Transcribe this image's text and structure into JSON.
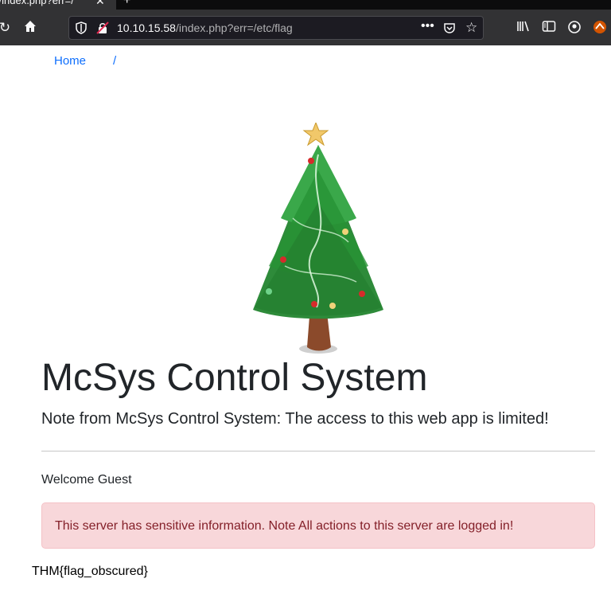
{
  "browser": {
    "tab_title": "s/index.php?err=/",
    "tab_close": "✕",
    "new_tab": "+",
    "url_host": "10.10.15.58",
    "url_path": "/index.php?err=/etc/flag",
    "icons": [
      "reload-icon",
      "home-icon",
      "shield-icon",
      "insecure-lock-icon",
      "more-icon",
      "pocket-icon",
      "bookmark-star-icon",
      "library-icon",
      "sidebar-icon",
      "account-icon",
      "extension-icon"
    ]
  },
  "breadcrumb": {
    "home": "Home",
    "separator": "/"
  },
  "main": {
    "title": "McSys Control System",
    "note": "Note from McSys Control System: The access to this web app is limited!",
    "welcome": "Welcome Guest",
    "alert": "This server has sensitive information. Note All actions to this server are logged in!",
    "flag": "THM{flag_obscured}"
  },
  "colors": {
    "link": "#0d6efd",
    "alert_bg": "#f8d7da",
    "alert_text": "#842029",
    "tree_green": "#2e8b3a"
  }
}
